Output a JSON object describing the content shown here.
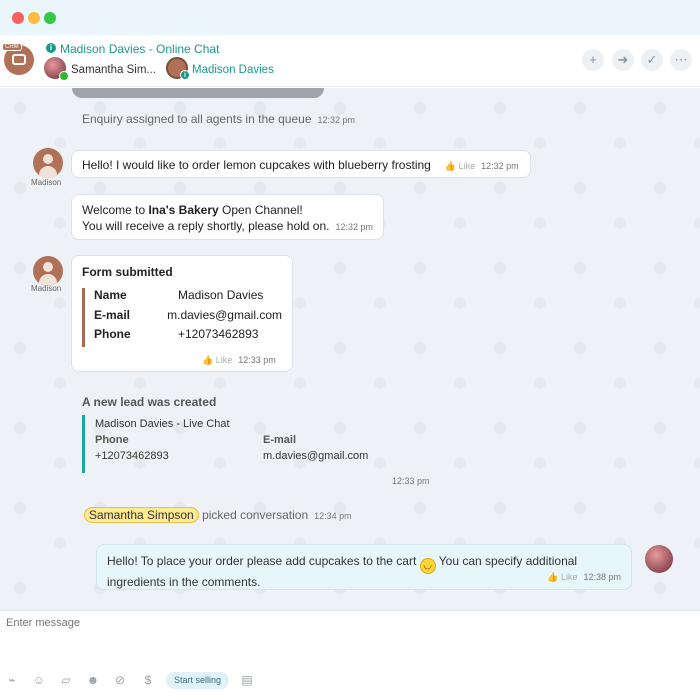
{
  "header": {
    "title": "Madison Davies - Online Chat",
    "agent_name": "Samantha Sim...",
    "customer_name": "Madison Davies",
    "icons": [
      "crm-icon",
      "info-icon",
      "add-icon",
      "forward-icon",
      "check-icon",
      "more-icon"
    ],
    "crm_tag": "CRM"
  },
  "chat": {
    "system_assigned": {
      "text": "Enquiry assigned to all agents in the queue",
      "time": "12:32 pm"
    },
    "customer_label": "Madison",
    "msg1": {
      "text": "Hello! I would like to order lemon cupcakes with blueberry frosting",
      "like": "Like",
      "time": "12:32 pm"
    },
    "welcome": {
      "line1_pre": "Welcome to ",
      "line1_bold": "Ina's Bakery",
      "line1_post": " Open Channel!",
      "line2": "You will receive a reply shortly, please hold on.",
      "time": "12:32 pm"
    },
    "form": {
      "title": "Form submitted",
      "rows": [
        {
          "key": "Name",
          "value": "Madison Davies"
        },
        {
          "key": "E-mail",
          "value": "m.davies@gmail.com"
        },
        {
          "key": "Phone",
          "value": "+12073462893"
        }
      ],
      "like": "Like",
      "time": "12:33 pm"
    },
    "lead": {
      "title": "A new lead was created",
      "name": "Madison Davies - Live Chat",
      "phone_label": "Phone",
      "phone": "+12073462893",
      "email_label": "E-mail",
      "email": "m.davies@gmail.com",
      "time": "12:33 pm"
    },
    "picked": {
      "agent": "Samantha Simpson",
      "text": "picked conversation",
      "time": "12:34 pm"
    },
    "agent_msg": {
      "pre": "Hello! To place your order please add cupcakes to the cart",
      "post": " You can specify additional ingredients in the comments.",
      "like": "Like",
      "time": "12:38 pm"
    }
  },
  "composer": {
    "placeholder": "Enter message",
    "start_selling": "Start selling",
    "tools": [
      "attach-icon",
      "user-icon",
      "template-icon",
      "emoji-icon",
      "hide-icon",
      "payment-icon",
      "document-icon"
    ]
  }
}
